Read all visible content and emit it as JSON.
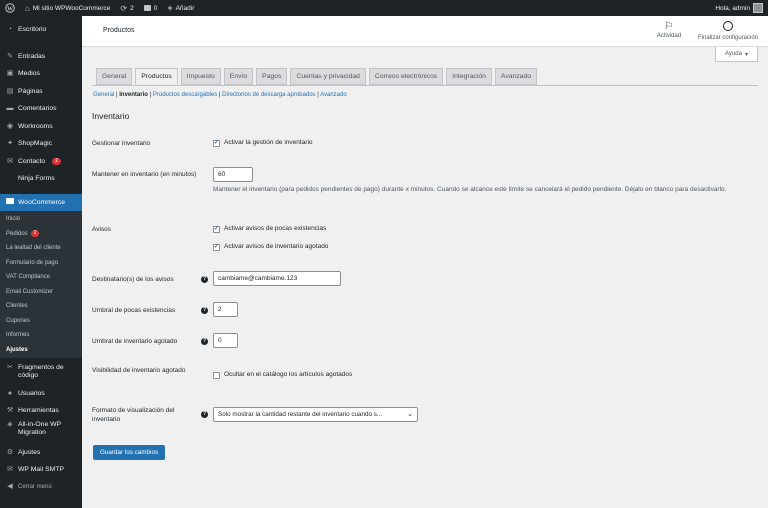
{
  "adminbar": {
    "site_name": "Mi sitio WPWooCommerce",
    "updates_count": "2",
    "comments_count": "0",
    "new_label": "Añadir",
    "greeting": "Hola, admin"
  },
  "sidebar": {
    "items_top": [
      {
        "label": "Escritorio",
        "icon": "dashboard-icon"
      },
      {
        "label": "Entradas",
        "icon": "pushpin-icon"
      },
      {
        "label": "Medios",
        "icon": "media-icon"
      },
      {
        "label": "Páginas",
        "icon": "pages-icon"
      },
      {
        "label": "Comentarios",
        "icon": "comments-icon"
      },
      {
        "label": "Workrooms",
        "icon": "workrooms-icon"
      },
      {
        "label": "ShopMagic",
        "icon": "shopmagic-icon"
      },
      {
        "label": "Contacto",
        "icon": "mail-icon",
        "badge": "2"
      },
      {
        "label": "Ninja Forms",
        "icon": "ninja-forms-icon"
      }
    ],
    "active_item": {
      "label": "WooCommerce",
      "icon": "woocommerce-icon"
    },
    "submenu": [
      {
        "label": "Inicio"
      },
      {
        "label": "Pedidos",
        "badge": "2"
      },
      {
        "label": "La lealtad del cliente"
      },
      {
        "label": "Formulario de pago"
      },
      {
        "label": "VAT Compliance"
      },
      {
        "label": "Email Customizer"
      },
      {
        "label": "Clientes"
      },
      {
        "label": "Cupones"
      },
      {
        "label": "Informes"
      },
      {
        "label": "Ajustes",
        "current": true
      }
    ],
    "items_bottom": [
      {
        "label": "Fragmentos de código",
        "icon": "code-snippets-icon"
      },
      {
        "label": "Usuarios",
        "icon": "users-icon"
      },
      {
        "label": "Herramientas",
        "icon": "tools-icon"
      },
      {
        "label": "All-in-One WP Migration",
        "icon": "migration-icon"
      },
      {
        "label": "Ajustes",
        "icon": "settings-icon"
      },
      {
        "label": "WP Mail SMTP",
        "icon": "wp-mail-smtp-icon"
      },
      {
        "label": "Cerrar menú",
        "icon": "collapse-icon"
      }
    ]
  },
  "header": {
    "title": "Productos",
    "activity_label": "Actividad",
    "finish_setup_label": "Finalizar configuración",
    "help_label": "Ayuda"
  },
  "tabs": [
    "General",
    "Productos",
    "Impuesto",
    "Envío",
    "Pagos",
    "Cuentas y privacidad",
    "Correos electrónicos",
    "Integración",
    "Avanzado"
  ],
  "active_tab": "Productos",
  "subsections": [
    "General",
    "Inventario",
    "Productos descargables",
    "Directorios de descarga aprobados",
    "Avanzado"
  ],
  "active_subsection": "Inventario",
  "section_title": "Inventario",
  "form": {
    "manage_stock": {
      "label": "Gestionar inventario",
      "checkbox_label": "Activar la gestión de inventario",
      "checked": true
    },
    "hold_stock": {
      "label": "Mantener en inventario (en minutos)",
      "value": "60",
      "description": "Mantener el inventario (para pedidos pendientes de pago) durante x minutos. Cuando se alcance este límite se cancelará el pedido pendiente. Déjalo en blanco para desactivarlo."
    },
    "notifications": {
      "label": "Avisos",
      "options": [
        {
          "label": "Activar avisos de pocas existencias",
          "checked": true
        },
        {
          "label": "Activar avisos de inventario agotado",
          "checked": true
        }
      ]
    },
    "recipient": {
      "label": "Destinatario(s) de los avisos",
      "value": "cambiame@cambiame.123"
    },
    "low_stock": {
      "label": "Umbral de pocas existencias",
      "value": "2"
    },
    "out_of_stock": {
      "label": "Umbral de inventario agotado",
      "value": "0"
    },
    "visibility": {
      "label": "Visibilidad de inventario agotado",
      "checkbox_label": "Ocultar en el catálogo los artículos agotados",
      "checked": false
    },
    "stock_format": {
      "label": "Formato de visualización del inventario",
      "selected": "Solo mostrar la cantidad restante del inventario cuando s..."
    }
  },
  "save_label": "Guardar los cambios",
  "colors": {
    "adminbar": "#1d2327",
    "accent": "#2271b1",
    "badge": "#d63638",
    "background": "#f0f0f1"
  }
}
